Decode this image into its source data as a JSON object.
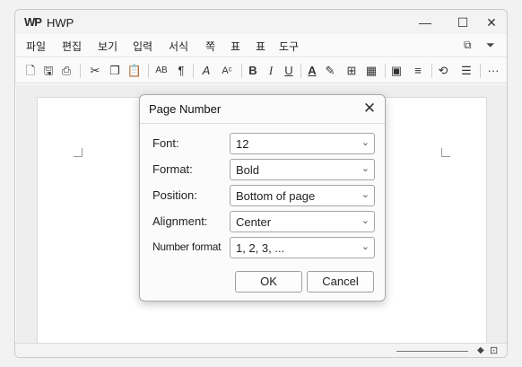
{
  "app": {
    "logo": "WP",
    "title": "HWP",
    "controls": {
      "minimize": "—",
      "maximize": "☐",
      "close": "✕"
    }
  },
  "menubar": {
    "items": [
      "파일",
      "편집",
      "보기",
      "입력",
      "서식",
      "쪽",
      "표",
      "표",
      "도구"
    ],
    "right_icons": [
      "restore-icon",
      "dropdown-icon"
    ]
  },
  "toolbar": {
    "icons": [
      "new-document-icon",
      "save-icon",
      "print-icon",
      "cut-icon",
      "copy-icon",
      "paste-icon",
      "spell-check-icon",
      "paragraph-mark-icon",
      "font-color-style-icon",
      "char-spacing-icon",
      "bold-icon",
      "italic-icon",
      "underline-icon",
      "text-color-icon",
      "highlight-icon",
      "table-icon",
      "grid-table-icon",
      "cell-icon",
      "align-icon",
      "shape-icon",
      "format-icon",
      "more-icon"
    ],
    "glyphs": {
      "bold": "B",
      "italic": "I",
      "underline": "U",
      "more": "···"
    }
  },
  "dialog": {
    "title": "Page Number",
    "close": "✕",
    "fields": [
      {
        "label": "Font:",
        "value": "12"
      },
      {
        "label": "Format:",
        "value": "Bold"
      },
      {
        "label": "Position:",
        "value": "Bottom of page"
      },
      {
        "label": "Alignment:",
        "value": "Center"
      },
      {
        "label": "Number format",
        "value": "1, 2, 3, ..."
      }
    ],
    "ok_label": "OK",
    "cancel_label": "Cancel"
  },
  "colors": {
    "window_bg": "#ffffff",
    "editor_bg": "#eeeeee",
    "dialog_bg": "#fbfbfb",
    "border": "#a5a5a5"
  }
}
